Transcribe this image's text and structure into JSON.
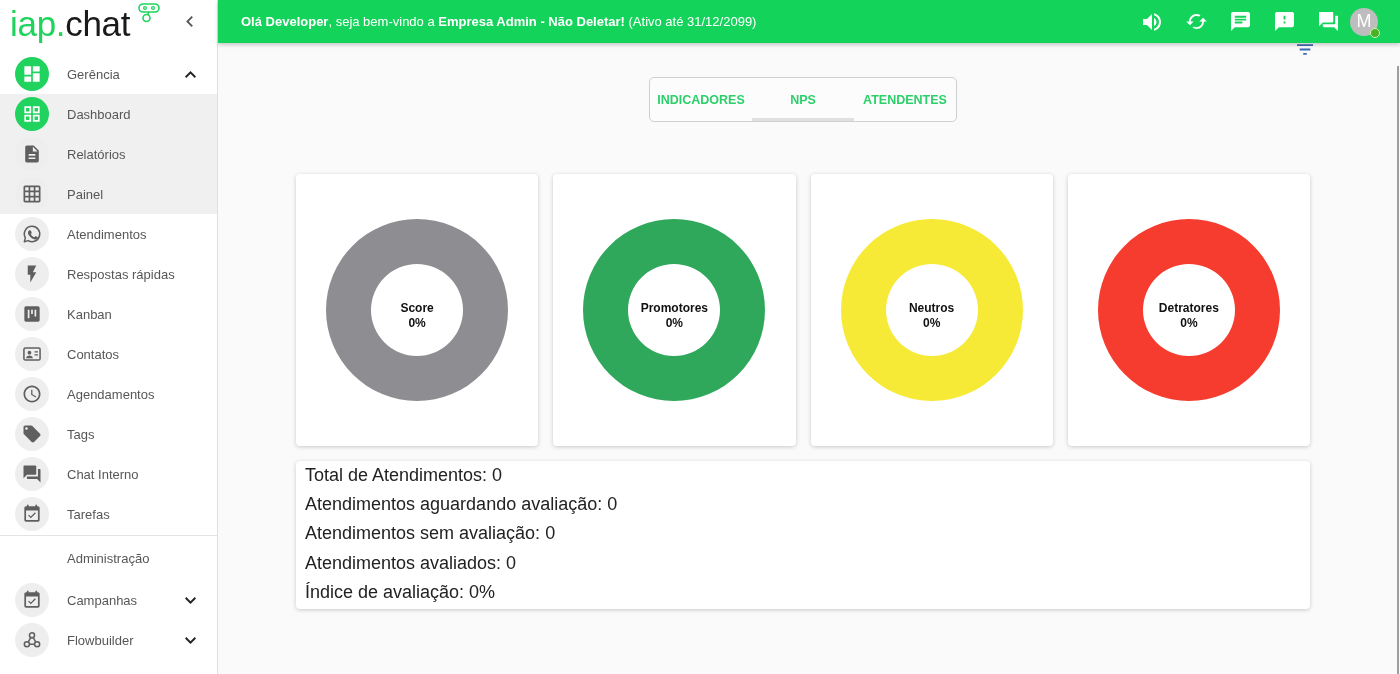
{
  "sidebar": {
    "logo": {
      "accent": "iap.",
      "text": "chat"
    },
    "items": [
      {
        "label": "Gerência",
        "kind": "group",
        "selected": true,
        "expanded": true,
        "children": [
          {
            "label": "Dashboard",
            "selected": true
          },
          {
            "label": "Relatórios",
            "selected": false
          },
          {
            "label": "Painel",
            "selected": false
          }
        ]
      },
      {
        "label": "Atendimentos",
        "kind": "link",
        "selected": false
      },
      {
        "label": "Respostas rápidas",
        "kind": "link",
        "selected": false
      },
      {
        "label": "Kanban",
        "kind": "link",
        "selected": false
      },
      {
        "label": "Contatos",
        "kind": "link",
        "selected": false
      },
      {
        "label": "Agendamentos",
        "kind": "link",
        "selected": false
      },
      {
        "label": "Tags",
        "kind": "link",
        "selected": false
      },
      {
        "label": "Chat Interno",
        "kind": "link",
        "selected": false
      },
      {
        "label": "Tarefas",
        "kind": "link",
        "selected": false
      }
    ],
    "section": {
      "title": "Administração",
      "items": [
        {
          "label": "Campanhas",
          "kind": "group",
          "selected": false,
          "expanded": false
        },
        {
          "label": "Flowbuilder",
          "kind": "group",
          "selected": false,
          "expanded": false
        }
      ]
    }
  },
  "header": {
    "greeting": "**Olá Developer**, seja bem-vindo a **Empresa Admin - Não Deletar!** (Ativo até 31/12/2099)",
    "user": {
      "initial": "M",
      "online": true
    }
  },
  "tabs": [
    {
      "label": "INDICADORES",
      "selected": false
    },
    {
      "label": "NPS",
      "selected": true
    },
    {
      "label": "ATENDENTES",
      "selected": false
    }
  ],
  "cards": [
    {
      "title": "Score",
      "value": "0%",
      "color": "#8e8d91"
    },
    {
      "title": "Promotores",
      "value": "0%",
      "color": "#2fa85b"
    },
    {
      "title": "Neutros",
      "value": "0%",
      "color": "#f6ea37"
    },
    {
      "title": "Detratores",
      "value": "0%",
      "color": "#f53c2f"
    }
  ],
  "summary": [
    "Total de Atendimentos: 0",
    "Atendimentos aguardando avaliação: 0",
    "Atendimentos sem avaliação: 0",
    "Atendimentos avaliados: 0",
    "Índice de avaliação: 0%"
  ]
}
